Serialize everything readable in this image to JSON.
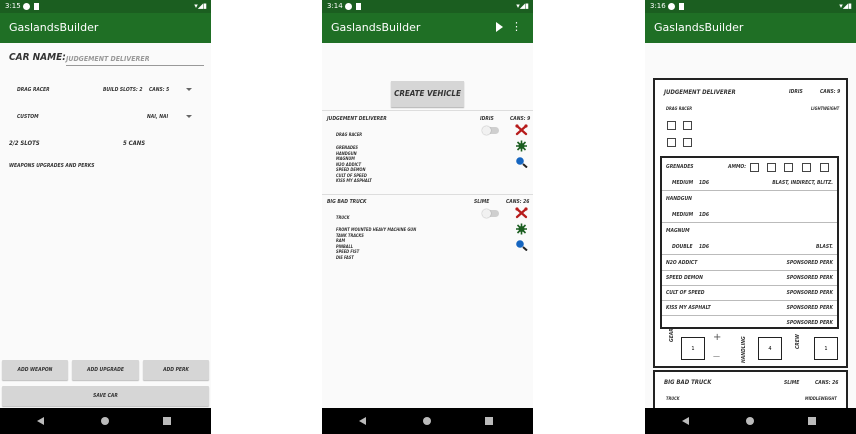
{
  "screens": [
    {
      "time": "3:15",
      "title": "GaslandsBuilder",
      "car_name_label": "CAR NAME:",
      "car_name_value": "JUDGEMENT DELIVERER",
      "vehicle_type": "DRAG RACER",
      "build_slots": "BUILD SLOTS: 2",
      "cans": "CANS: 5",
      "subtype": "CUSTOM",
      "sponsor_options": "NAI, NAI",
      "slots_text": "2/2 SLOTS",
      "cans_total": "5 CANS",
      "weapons_label": "WEAPONS UPGRADES AND PERKS",
      "buttons": {
        "add_weapon": "ADD WEAPON",
        "add_upgrade": "ADD UPGRADE",
        "add_perk": "ADD PERK",
        "save": "SAVE CAR"
      }
    },
    {
      "time": "3:14",
      "title": "GaslandsBuilder",
      "create_vehicle": "CREATE VEHICLE",
      "vehicles": [
        {
          "name": "JUDGEMENT DELIVERER",
          "sponsor": "IDRIS",
          "cans": "CANS: 9",
          "type": "DRAG RACER",
          "items": [
            "GRENADES",
            "HANDGUN",
            "MAGNUM",
            "N2O ADDICT",
            "SPEED DEMON",
            "CULT OF SPEED",
            "KISS MY ASPHALT"
          ]
        },
        {
          "name": "BIG BAD TRUCK",
          "sponsor": "SLIME",
          "cans": "CANS: 26",
          "type": "TRUCK",
          "items": [
            "FRONT MOUNTED HEAVY MACHINE GUN",
            "TANK TRACKS",
            "RAM",
            "PINBALL",
            "SPEED FIST",
            "DIE FAST"
          ]
        }
      ]
    },
    {
      "time": "3:16",
      "title": "GaslandsBuilder",
      "card": {
        "name": "JUDGEMENT DELIVERER",
        "sponsor": "IDRIS",
        "cans": "CANS: 9",
        "type": "DRAG RACER",
        "weight": "LIGHTWEIGHT",
        "ammo_label": "AMMO:",
        "weapons": [
          {
            "name": "GRENADES",
            "range": "MEDIUM",
            "dice": "1D6",
            "specials": "BLAST, INDIRECT, BLITZ."
          },
          {
            "name": "HANDGUN",
            "range": "MEDIUM",
            "dice": "1D6",
            "specials": ""
          },
          {
            "name": "MAGNUM",
            "range": "DOUBLE",
            "dice": "1D6",
            "specials": "BLAST."
          }
        ],
        "perks": [
          {
            "name": "N2O ADDICT",
            "source": "SPONSORED PERK"
          },
          {
            "name": "SPEED DEMON",
            "source": "SPONSORED PERK"
          },
          {
            "name": "CULT OF SPEED",
            "source": "SPONSORED PERK"
          },
          {
            "name": "KISS MY ASPHALT",
            "source": "SPONSORED PERK"
          },
          {
            "name": "",
            "source": "SPONSORED PERK"
          }
        ],
        "gear_label": "GEAR",
        "gear_value": "1",
        "handling_label": "HANDLING",
        "handling_value": "4",
        "crew_label": "CREW",
        "crew_value": "1",
        "plus": "+",
        "minus": "—"
      },
      "next": {
        "name": "BIG BAD TRUCK",
        "sponsor": "SLIME",
        "cans": "CANS: 26",
        "type": "TRUCK",
        "weight": "MIDDLEWEIGHT"
      }
    }
  ]
}
